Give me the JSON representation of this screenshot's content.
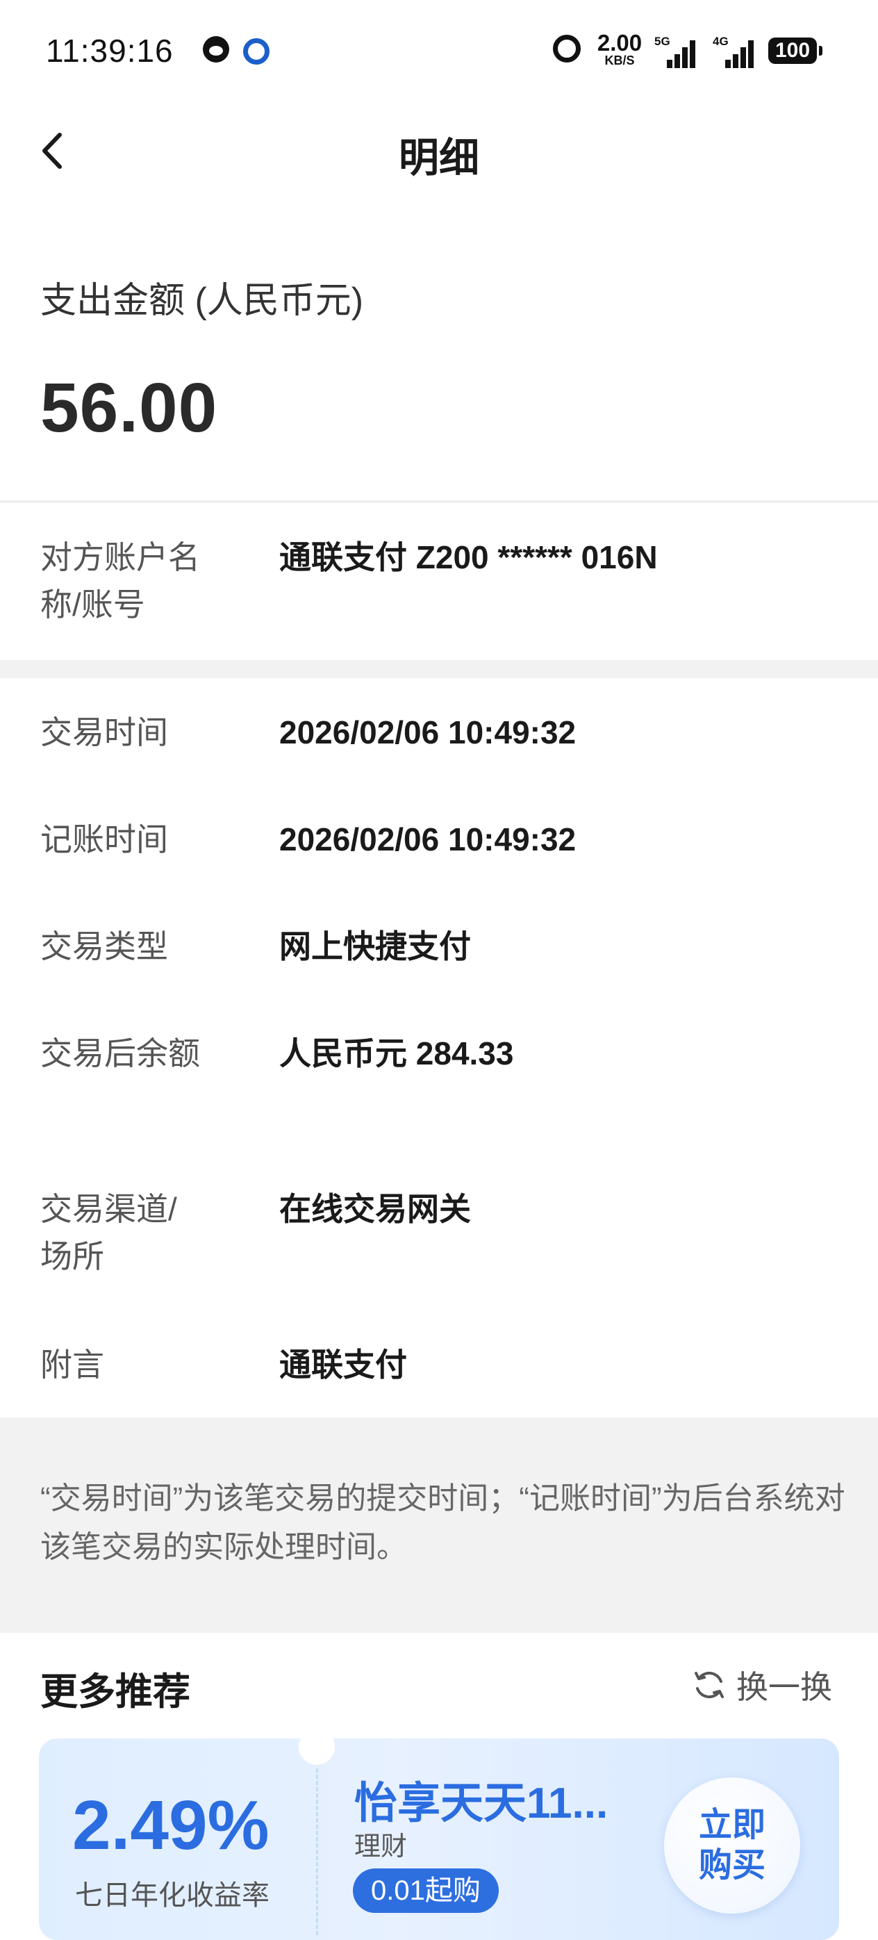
{
  "status_bar": {
    "time": "11:39:16",
    "net_speed": "2.00",
    "net_unit": "KB/S",
    "signal_1": "5G",
    "signal_2": "4G",
    "battery": "100"
  },
  "header": {
    "title": "明细",
    "back_icon": "chevron-left-icon"
  },
  "amount": {
    "label": "支出金额 (人民币元)",
    "value": "56.00"
  },
  "counterparty": {
    "label": "对方账户名称/账号",
    "value": "通联支付 Z200 ****** 016N"
  },
  "details": [
    {
      "label": "交易时间",
      "value": "2026/02/06 10:49:32"
    },
    {
      "label": "记账时间",
      "value": "2026/02/06 10:49:32"
    },
    {
      "label": "交易类型",
      "value": "网上快捷支付"
    },
    {
      "label": "交易后余额",
      "value": "人民币元 284.33"
    },
    {
      "label": "交易渠道/场所",
      "value": "在线交易网关"
    },
    {
      "label": "附言",
      "value": "通联支付"
    }
  ],
  "notice": "“交易时间”为该笔交易的提交时间；“记账时间”为后台系统对该笔交易的实际处理时间。",
  "recommend": {
    "title": "更多推荐",
    "refresh_label": "换一换",
    "card": {
      "rate": "2.49%",
      "rate_label": "七日年化收益率",
      "product_name": "怡享天天11...",
      "product_type": "理财",
      "min_purchase": "0.01起购",
      "buy_label": "立即购买"
    }
  },
  "colors": {
    "accent": "#2b6de0",
    "background_band": "#f2f2f2"
  }
}
